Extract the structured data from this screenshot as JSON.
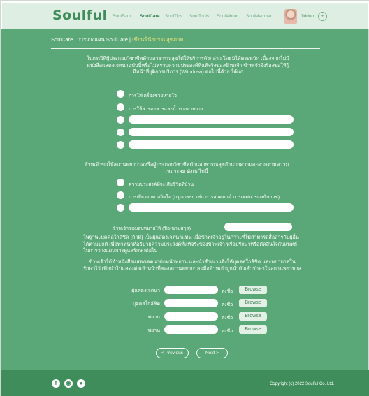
{
  "app": {
    "logo": "Soulful"
  },
  "nav": {
    "items": [
      {
        "label": "SoulFam",
        "active": false
      },
      {
        "label": "SoulCare",
        "active": true
      },
      {
        "label": "SoulTips",
        "active": false
      },
      {
        "label": "SoulTools",
        "active": false
      },
      {
        "label": "SoulAlbum",
        "active": false
      },
      {
        "label": "SoulMember",
        "active": false
      }
    ],
    "user": "Jiddoo",
    "menu_glyph": "+"
  },
  "breadcrumb": {
    "path": "SoulCare | การวางแผน SoulCare | ",
    "current": "เขียนพินัยกรรมสุขภาพ"
  },
  "form": {
    "intro": "ในกรณีที่ผู้ประกอบวิชาชีพด้านสาธารณสุขได้ให้บริการดังกล่าว โดยมิได้ตระหนัก เนื่องจากไม่มีหนังสือแสดงเจตนาฉบับนี้หรือไม่ทราบความประสงค์ที่แท้จริงของข้าพเจ้า ข้าพเจ้าจึงร้องขอให้ผู้มีหน้าที่ยุติการบริการ (Withdraw) ต่อไปนี้ด้วย ได้แก่",
    "options_1": [
      "การใส่เครื่องช่วยหายใจ",
      "การให้สารอาหารและน้ำทางสายยาง"
    ],
    "section_2": "ข้าพเจ้าขอให้สถานพยาบาลหรือผู้ประกอบวิชาชีพด้านสาธารณสุขอำนวยความสะดวกตามความเหมาะสม ดังต่อไปนี้",
    "options_2": [
      "ความประสงค์ที่จะเสียชีวิตที่บ้าน",
      "การเยียวยาทางจิตใจ (กรุณาระบุ เช่น การสวดมนต์ การเทศนาของนักบวช)"
    ],
    "proxy_label": "ข้าพเจ้าขอมอบหมายให้ (ชื่อ-นามสกุล)",
    "proxy_text": "ในฐานะบุคคลใกล้ชิด (ถ้ามี) เป็นผู้แสดงเจตนาแทน เมื่อข้าพเจ้าอยู่ในภาวะที่ไม่สามารถสื่อสารกับผู้อื่นได้ตามปกติ เพื่อทำหน้าที่อธิบายความประสงค์ที่แท้จริงของข้าพเจ้า หรือปรึกษาหรือตัดสินใจกับแพทย์ในการวางแผนการดูแลรักษาต่อไป",
    "declaration": "ข้าพเจ้าได้ทำหนังสือแสดงเจตนาต่อหน้าพยาน และนำสำเนาแจ้งให้บุคคลใกล้ชิด และพยาบาลในรักษาไว้ เพื่อนำไปแสดงต่อเจ้าหน้าที่ของสถานพยาบาล เมื่อข้าพเจ้าถูกนำตัวเข้ารักษาในสถานพยาบาล"
  },
  "signatures": {
    "sign_word": "ลงชื่อ",
    "browse_label": "Browse",
    "rows": [
      {
        "label": "ผู้แสดงเจตนา"
      },
      {
        "label": "บุคคลใกล้ชิด"
      },
      {
        "label": "พยาน"
      },
      {
        "label": "พยาน"
      }
    ]
  },
  "pager": {
    "previous": "< Previous",
    "next": "Next >"
  },
  "footer": {
    "social_icons": [
      "facebook-icon",
      "instagram-icon",
      "line-icon"
    ],
    "copyright": "Copyright (c) 2022 Soulful Co. Ltd."
  },
  "colors": {
    "background": "#5aa877",
    "header": "#dfeee3",
    "footer": "#3e8d5b",
    "breadcrumb_current": "#f4e77a"
  }
}
